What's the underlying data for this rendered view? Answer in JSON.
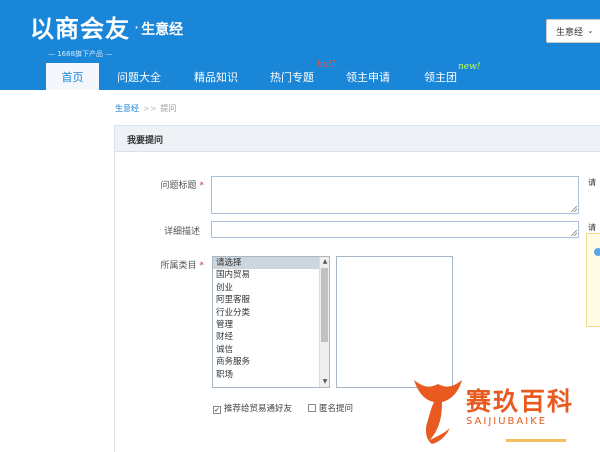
{
  "header": {
    "logo_main": "以商会友",
    "logo_dot": "·",
    "logo_sub": "生意经",
    "logo_tag": "— 1688旗下产品 —",
    "top_select": "生意经"
  },
  "nav": {
    "items": [
      {
        "label": "首页"
      },
      {
        "label": "问题大全"
      },
      {
        "label": "精品知识"
      },
      {
        "label": "热门专题"
      },
      {
        "label": "领主申请"
      },
      {
        "label": "领主团"
      }
    ],
    "badge_hot": "hot!",
    "badge_new": "new!"
  },
  "breadcrumb": {
    "home": "生意经",
    "sep": ">>",
    "current": "提问"
  },
  "form": {
    "panel_title": "我要提问",
    "title_label": "问题标题",
    "desc_label": "详细描述",
    "category_label": "所属类目",
    "required_mark": "*",
    "categories": [
      "请选择",
      "国内贸易",
      "创业",
      "阿里客服",
      "行业分类",
      "管理",
      "财经",
      "诚信",
      "商务服务",
      "职场"
    ],
    "recommend_label": "推荐给贸易通好友",
    "anonymous_label": "匿名提问",
    "hint_1": "请",
    "hint_2": "请"
  },
  "watermark": {
    "title": "赛玖百科",
    "sub": "SAIJIUBAIKE"
  },
  "colors": {
    "header_bg": "#1a86d8",
    "watermark": "#e85a20"
  }
}
